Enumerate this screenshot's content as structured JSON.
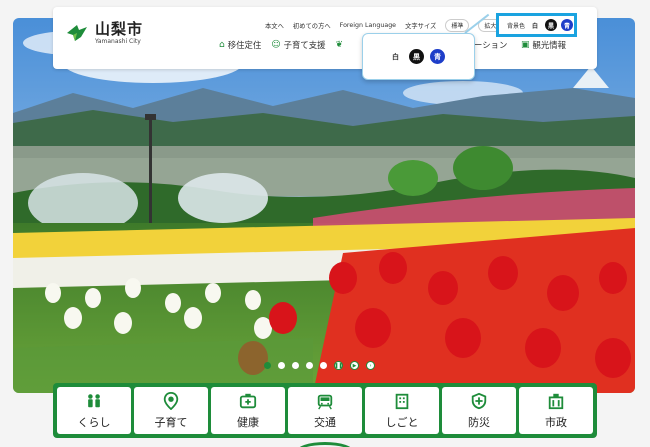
{
  "logo": {
    "name_jp": "山梨市",
    "name_en": "Yamanashi City"
  },
  "utility": {
    "links": [
      "本文へ",
      "初めての方へ",
      "Foreign Language"
    ],
    "font_size_label": "文字サイズ",
    "font_size_standard": "標準",
    "font_size_large": "拡大",
    "bg_label": "背景色",
    "bg_white": "白",
    "bg_black": "黒",
    "bg_blue": "青"
  },
  "nav": {
    "items": [
      {
        "label": "移住定住",
        "icon": "home-icon"
      },
      {
        "label": "子育て支援",
        "icon": "child-icon"
      },
      {
        "label": "ーション",
        "icon": "leaf-icon"
      },
      {
        "label": "観光情報",
        "icon": "camera-icon"
      }
    ]
  },
  "popup": {
    "white": "白",
    "black": "黒",
    "blue": "青"
  },
  "categories": [
    {
      "label": "くらし",
      "icon": "family-icon"
    },
    {
      "label": "子育て",
      "icon": "child-pin-icon"
    },
    {
      "label": "健康",
      "icon": "medical-box-icon"
    },
    {
      "label": "交通",
      "icon": "train-icon"
    },
    {
      "label": "しごと",
      "icon": "work-icon"
    },
    {
      "label": "防災",
      "icon": "shield-icon"
    },
    {
      "label": "市政",
      "icon": "building-icon"
    }
  ],
  "colors": {
    "brand_green": "#1e8c3a",
    "accent_blue": "#1aa3e0"
  }
}
